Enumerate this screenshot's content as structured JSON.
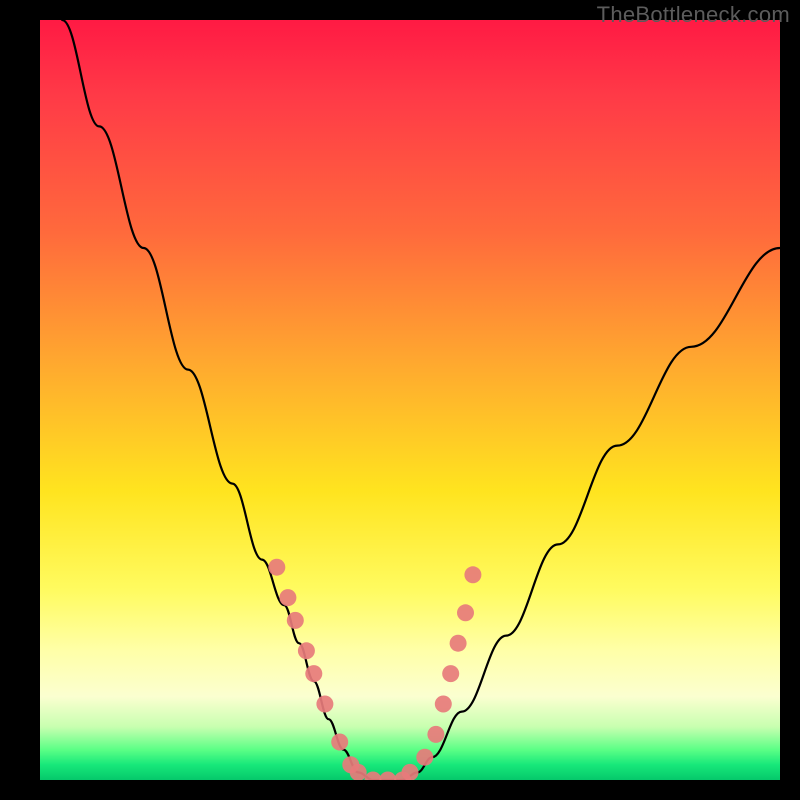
{
  "watermark": "TheBottleneck.com",
  "chart_data": {
    "type": "line",
    "title": "",
    "xlabel": "",
    "ylabel": "",
    "ylim": [
      0,
      100
    ],
    "xlim": [
      0,
      100
    ],
    "series": [
      {
        "name": "curve",
        "x": [
          3,
          8,
          14,
          20,
          26,
          30,
          33,
          35,
          37,
          39,
          41,
          43,
          45,
          47,
          49,
          51,
          53,
          57,
          63,
          70,
          78,
          88,
          100
        ],
        "y": [
          100,
          86,
          70,
          54,
          39,
          29,
          23,
          18,
          13,
          8,
          4,
          1,
          0,
          0,
          0,
          1,
          3,
          9,
          19,
          31,
          44,
          57,
          70
        ]
      }
    ],
    "markers": {
      "name": "dots",
      "x": [
        32,
        33.5,
        34.5,
        36,
        37,
        38.5,
        40.5,
        42,
        43,
        45,
        47,
        49,
        50,
        52,
        53.5,
        54.5,
        55.5,
        56.5,
        57.5,
        58.5
      ],
      "y": [
        28,
        24,
        21,
        17,
        14,
        10,
        5,
        2,
        1,
        0,
        0,
        0,
        1,
        3,
        6,
        10,
        14,
        18,
        22,
        27
      ]
    },
    "colors": {
      "curve": "#000000",
      "markers": "#e77b7b"
    }
  }
}
